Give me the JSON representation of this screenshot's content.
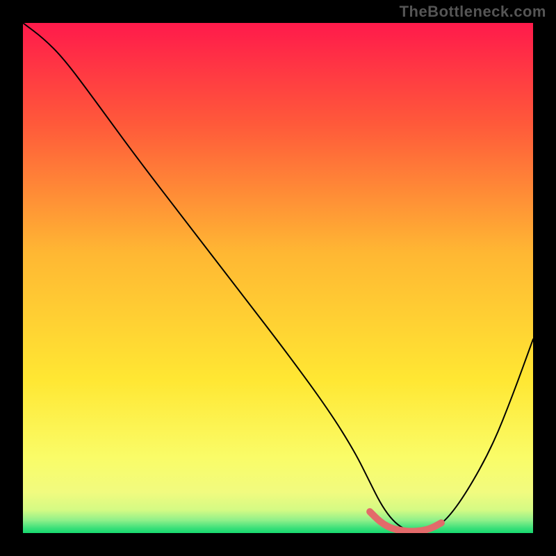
{
  "brand": "TheBottleneck.com",
  "chart_data": {
    "type": "line",
    "title": "",
    "xlabel": "",
    "ylabel": "",
    "xlim": [
      0,
      100
    ],
    "ylim": [
      0,
      100
    ],
    "gradient_stops": [
      {
        "offset": 0,
        "color": "#ff1a4b"
      },
      {
        "offset": 0.2,
        "color": "#ff5a3a"
      },
      {
        "offset": 0.45,
        "color": "#ffb733"
      },
      {
        "offset": 0.7,
        "color": "#ffe733"
      },
      {
        "offset": 0.85,
        "color": "#fafc67"
      },
      {
        "offset": 0.92,
        "color": "#f1fb7f"
      },
      {
        "offset": 0.955,
        "color": "#d4fa84"
      },
      {
        "offset": 0.975,
        "color": "#8ff08a"
      },
      {
        "offset": 0.99,
        "color": "#3de07a"
      },
      {
        "offset": 1.0,
        "color": "#16d86e"
      }
    ],
    "series": [
      {
        "name": "bottleneck-curve",
        "x": [
          0,
          4,
          8,
          14,
          22,
          32,
          42,
          52,
          60,
          65,
          68,
          70,
          72,
          74,
          76,
          78,
          80,
          83,
          87,
          92,
          96,
          100
        ],
        "y": [
          100,
          97,
          93,
          85,
          74,
          61,
          48,
          35,
          24,
          16,
          10,
          6,
          3,
          1.2,
          0.3,
          0.2,
          0.6,
          2.5,
          8,
          17,
          27,
          38
        ]
      }
    ],
    "optimal_range": {
      "name": "optimal-range-marker",
      "x": [
        68,
        70,
        72,
        74,
        76,
        78,
        80,
        82
      ],
      "y": [
        4.2,
        2.2,
        1.0,
        0.5,
        0.3,
        0.4,
        0.9,
        2.0
      ]
    }
  }
}
